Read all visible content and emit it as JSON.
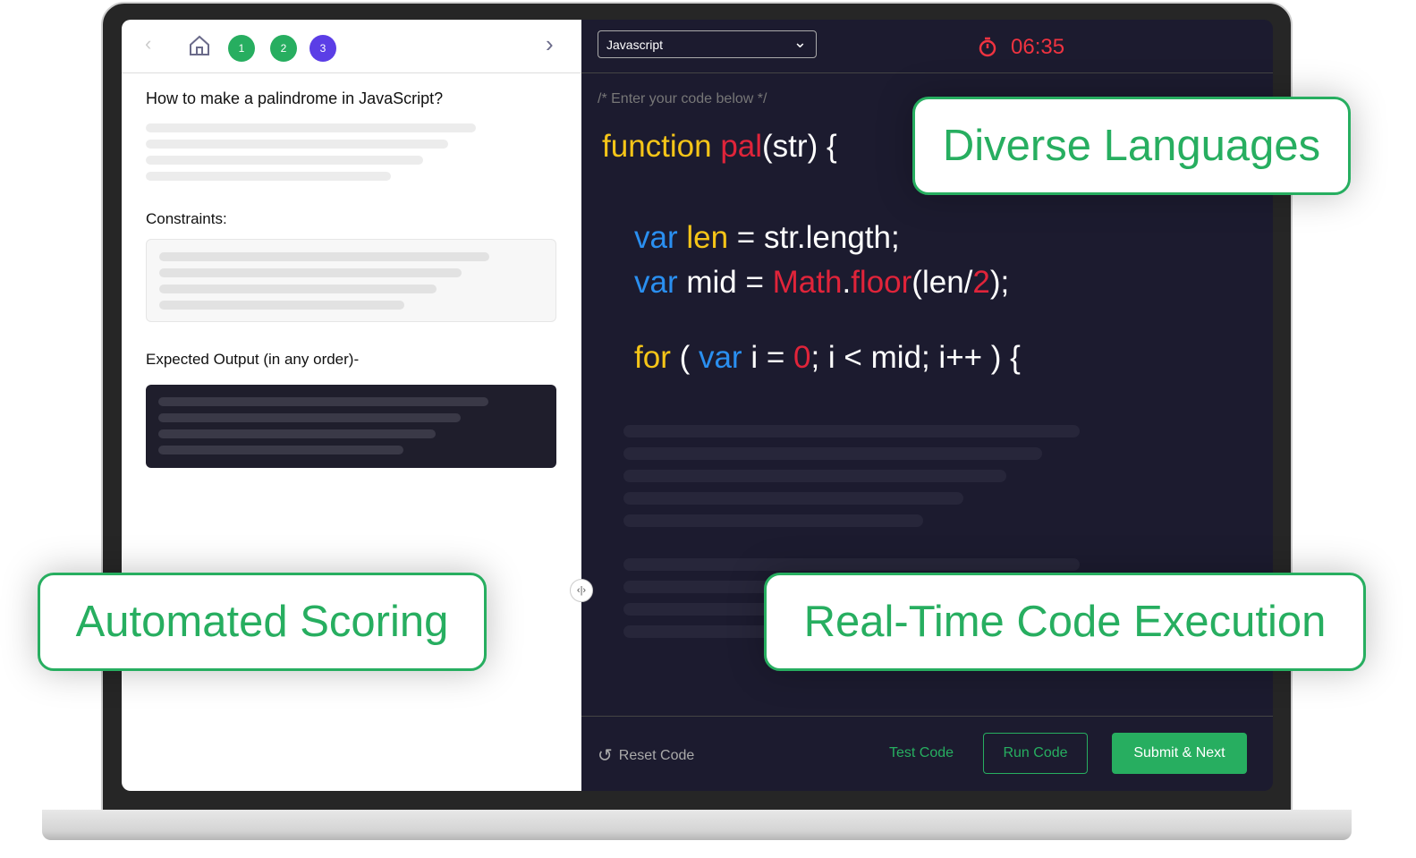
{
  "nav": {
    "steps": [
      {
        "label": "1",
        "color": "#27ae60"
      },
      {
        "label": "2",
        "color": "#27ae60"
      },
      {
        "label": "3",
        "color": "#5b3ee6"
      }
    ]
  },
  "question": {
    "title": "How to make a palindrome in JavaScript?",
    "constraints_label": "Constraints:",
    "expected_label": "Expected Output (in any order)-"
  },
  "editor": {
    "language": "Javascript",
    "timer": "06:35",
    "comment": "/* Enter your code below */",
    "lines": [
      [
        {
          "t": "function ",
          "c": "#f5c518"
        },
        {
          "t": "pal",
          "c": "#e0243a"
        },
        {
          "t": "(str) {",
          "c": "#ffffff"
        }
      ],
      [
        {
          "t": "var ",
          "c": "#2a8ff0"
        },
        {
          "t": "len",
          "c": "#f5c518"
        },
        {
          "t": " = str.length;",
          "c": "#ffffff"
        }
      ],
      [
        {
          "t": "var ",
          "c": "#2a8ff0"
        },
        {
          "t": "mid = ",
          "c": "#ffffff"
        },
        {
          "t": "Math",
          "c": "#e0243a"
        },
        {
          "t": ".",
          "c": "#ffffff"
        },
        {
          "t": "floor",
          "c": "#e0243a"
        },
        {
          "t": "(len/",
          "c": "#ffffff"
        },
        {
          "t": "2",
          "c": "#e0243a"
        },
        {
          "t": ");",
          "c": "#ffffff"
        }
      ],
      [
        {
          "t": "for",
          "c": "#f5c518"
        },
        {
          "t": " ( ",
          "c": "#ffffff"
        },
        {
          "t": "var ",
          "c": "#2a8ff0"
        },
        {
          "t": "i = ",
          "c": "#ffffff"
        },
        {
          "t": "0",
          "c": "#e0243a"
        },
        {
          "t": "; i < mid; i++ ) {",
          "c": "#ffffff"
        }
      ]
    ]
  },
  "footer": {
    "reset": "Reset Code",
    "test": "Test Code",
    "run": "Run Code",
    "submit": "Submit & Next"
  },
  "callouts": {
    "languages": "Diverse Languages",
    "scoring": "Automated Scoring",
    "execution": "Real-Time Code Execution"
  },
  "colors": {
    "accent": "#27ae60",
    "timer": "#ef3340",
    "editor_bg": "#1c1b2f"
  }
}
